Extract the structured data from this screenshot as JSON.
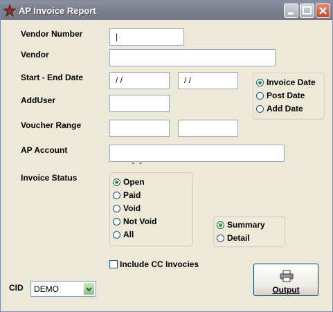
{
  "window": {
    "title": "AP Invoice Report",
    "controls": [
      "minimize-icon",
      "maximize-icon",
      "close-icon"
    ]
  },
  "form": {
    "vendor_number": {
      "label": "Vendor Number",
      "value": "|"
    },
    "vendor": {
      "label": "Vendor",
      "value": ""
    },
    "date_range": {
      "label": "Start - End Date",
      "start": "/ /",
      "end": "/ /"
    },
    "date_type": {
      "options": [
        "Invoice Date",
        "Post Date",
        "Add Date"
      ],
      "selected": "Invoice Date"
    },
    "add_user": {
      "label": "AddUser",
      "value": ""
    },
    "voucher_range": {
      "label": "Voucher Range",
      "start": "",
      "end": ""
    },
    "ap_account": {
      "label": "AP Account",
      "value": "-  -"
    },
    "invoice_status": {
      "label": "Invoice Status",
      "options": [
        "Open",
        "Paid",
        "Void",
        "Not Void",
        "All"
      ],
      "selected": "Open"
    },
    "report_type": {
      "options": [
        "Summary",
        "Detail"
      ],
      "selected": "Summary"
    },
    "include_cc": {
      "label": "Include CC Invocies",
      "checked": false
    },
    "cid": {
      "label": "CID",
      "value": "DEMO"
    }
  },
  "buttons": {
    "output": "Output"
  },
  "colors": {
    "selected_radio": "#21A121",
    "titlebar": "#7B7F8E",
    "dialog_bg": "#ECE9D8"
  }
}
